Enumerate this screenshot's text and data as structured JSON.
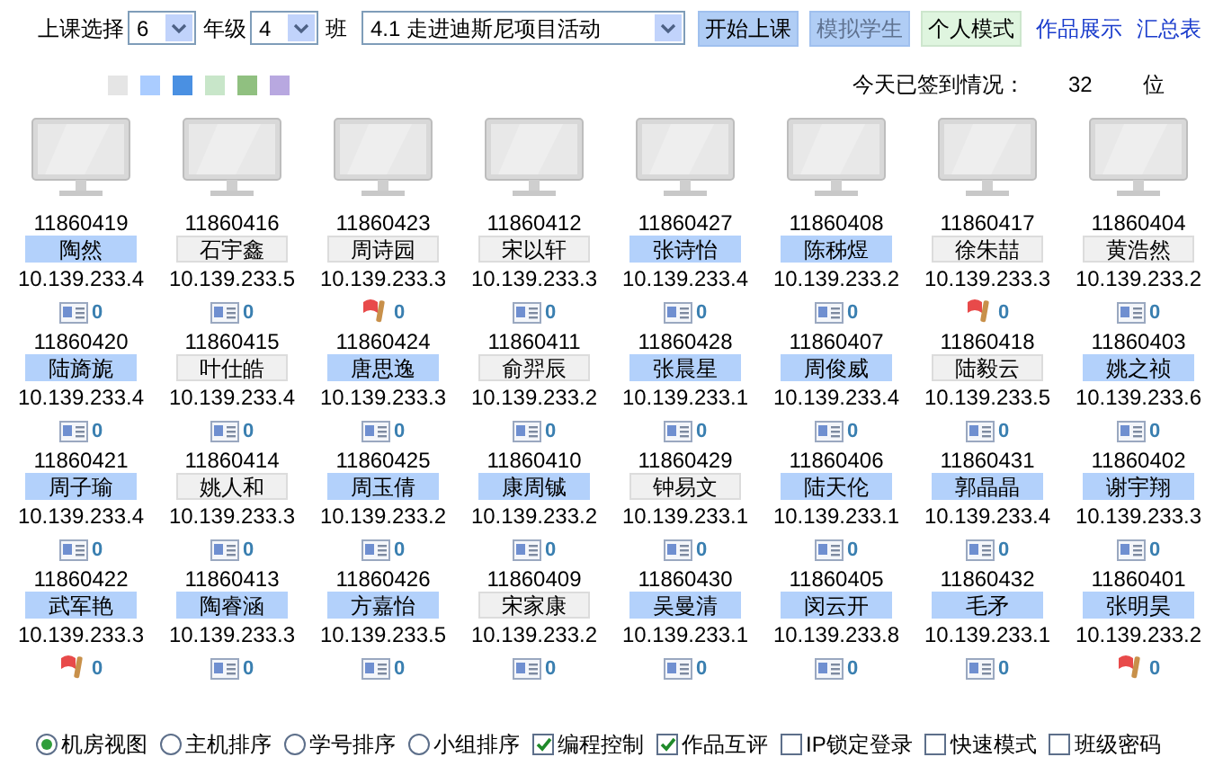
{
  "toolbar": {
    "grade_label": "上课选择",
    "grade": "6",
    "class_label_1": "年级",
    "class": "4",
    "class_label_2": "班",
    "lesson": "4.1 走进迪斯尼项目活动",
    "buttons": [
      {
        "label": "开始上课",
        "kind": "primary",
        "disabled": false
      },
      {
        "label": "模拟学生",
        "kind": "primary",
        "disabled": true
      },
      {
        "label": "个人模式",
        "kind": "mode",
        "disabled": false
      }
    ],
    "links": [
      "作品展示",
      "汇总表"
    ]
  },
  "legend": [
    {
      "color": "#e5e5e5"
    },
    {
      "color": "#aaccff"
    },
    {
      "color": "#4a90e2"
    },
    {
      "color": "#c8e6c9"
    },
    {
      "color": "#90c080"
    },
    {
      "color": "#b8a8e0"
    }
  ],
  "signin": {
    "label": "今天已签到情况：",
    "count": "32",
    "unit": "位"
  },
  "students": [
    {
      "id": "11860419",
      "name": "陶然",
      "highlighted": true,
      "ip": "10.139.233.4",
      "kind": "card",
      "count": "0",
      "monitor": true
    },
    {
      "id": "11860416",
      "name": "石宇鑫",
      "highlighted": false,
      "ip": "10.139.233.5",
      "kind": "card",
      "count": "0",
      "monitor": true
    },
    {
      "id": "11860423",
      "name": "周诗园",
      "highlighted": false,
      "ip": "10.139.233.3",
      "kind": "flag",
      "count": "0",
      "monitor": true
    },
    {
      "id": "11860412",
      "name": "宋以轩",
      "highlighted": false,
      "ip": "10.139.233.3",
      "kind": "card",
      "count": "0",
      "monitor": true
    },
    {
      "id": "11860427",
      "name": "张诗怡",
      "highlighted": true,
      "ip": "10.139.233.4",
      "kind": "card",
      "count": "0",
      "monitor": true
    },
    {
      "id": "11860408",
      "name": "陈秭煜",
      "highlighted": true,
      "ip": "10.139.233.2",
      "kind": "card",
      "count": "0",
      "monitor": true
    },
    {
      "id": "11860417",
      "name": "徐朱喆",
      "highlighted": false,
      "ip": "10.139.233.3",
      "kind": "flag",
      "count": "0",
      "monitor": true
    },
    {
      "id": "11860404",
      "name": "黄浩然",
      "highlighted": false,
      "ip": "10.139.233.2",
      "kind": "card",
      "count": "0",
      "monitor": true
    },
    {
      "id": "11860420",
      "name": "陆旖旎",
      "highlighted": true,
      "ip": "10.139.233.4",
      "kind": "card",
      "count": "0",
      "monitor": false
    },
    {
      "id": "11860415",
      "name": "叶仕皓",
      "highlighted": false,
      "ip": "10.139.233.4",
      "kind": "card",
      "count": "0",
      "monitor": false
    },
    {
      "id": "11860424",
      "name": "唐思逸",
      "highlighted": true,
      "ip": "10.139.233.3",
      "kind": "card",
      "count": "0",
      "monitor": false
    },
    {
      "id": "11860411",
      "name": "俞羿辰",
      "highlighted": false,
      "ip": "10.139.233.2",
      "kind": "card",
      "count": "0",
      "monitor": false
    },
    {
      "id": "11860428",
      "name": "张晨星",
      "highlighted": true,
      "ip": "10.139.233.1",
      "kind": "card",
      "count": "0",
      "monitor": false
    },
    {
      "id": "11860407",
      "name": "周俊威",
      "highlighted": true,
      "ip": "10.139.233.4",
      "kind": "card",
      "count": "0",
      "monitor": false
    },
    {
      "id": "11860418",
      "name": "陆毅云",
      "highlighted": false,
      "ip": "10.139.233.5",
      "kind": "card",
      "count": "0",
      "monitor": false
    },
    {
      "id": "11860403",
      "name": "姚之祯",
      "highlighted": true,
      "ip": "10.139.233.6",
      "kind": "card",
      "count": "0",
      "monitor": false
    },
    {
      "id": "11860421",
      "name": "周子瑜",
      "highlighted": true,
      "ip": "10.139.233.4",
      "kind": "card",
      "count": "0",
      "monitor": false
    },
    {
      "id": "11860414",
      "name": "姚人和",
      "highlighted": false,
      "ip": "10.139.233.3",
      "kind": "card",
      "count": "0",
      "monitor": false
    },
    {
      "id": "11860425",
      "name": "周玉倩",
      "highlighted": true,
      "ip": "10.139.233.2",
      "kind": "card",
      "count": "0",
      "monitor": false
    },
    {
      "id": "11860410",
      "name": "康周铖",
      "highlighted": true,
      "ip": "10.139.233.2",
      "kind": "card",
      "count": "0",
      "monitor": false
    },
    {
      "id": "11860429",
      "name": "钟易文",
      "highlighted": false,
      "ip": "10.139.233.1",
      "kind": "card",
      "count": "0",
      "monitor": false
    },
    {
      "id": "11860406",
      "name": "陆天伦",
      "highlighted": true,
      "ip": "10.139.233.1",
      "kind": "card",
      "count": "0",
      "monitor": false
    },
    {
      "id": "11860431",
      "name": "郭晶晶",
      "highlighted": true,
      "ip": "10.139.233.4",
      "kind": "card",
      "count": "0",
      "monitor": false
    },
    {
      "id": "11860402",
      "name": "谢宇翔",
      "highlighted": true,
      "ip": "10.139.233.3",
      "kind": "card",
      "count": "0",
      "monitor": false
    },
    {
      "id": "11860422",
      "name": "武军艳",
      "highlighted": true,
      "ip": "10.139.233.3",
      "kind": "flag",
      "count": "0",
      "monitor": false
    },
    {
      "id": "11860413",
      "name": "陶睿涵",
      "highlighted": true,
      "ip": "10.139.233.3",
      "kind": "card",
      "count": "0",
      "monitor": false
    },
    {
      "id": "11860426",
      "name": "方嘉怡",
      "highlighted": true,
      "ip": "10.139.233.5",
      "kind": "card",
      "count": "0",
      "monitor": false
    },
    {
      "id": "11860409",
      "name": "宋家康",
      "highlighted": false,
      "ip": "10.139.233.2",
      "kind": "card",
      "count": "0",
      "monitor": false
    },
    {
      "id": "11860430",
      "name": "吴曼清",
      "highlighted": true,
      "ip": "10.139.233.1",
      "kind": "card",
      "count": "0",
      "monitor": false
    },
    {
      "id": "11860405",
      "name": "闵云开",
      "highlighted": true,
      "ip": "10.139.233.8",
      "kind": "card",
      "count": "0",
      "monitor": false
    },
    {
      "id": "11860432",
      "name": "毛矛",
      "highlighted": true,
      "ip": "10.139.233.1",
      "kind": "card",
      "count": "0",
      "monitor": false
    },
    {
      "id": "11860401",
      "name": "张明昊",
      "highlighted": true,
      "ip": "10.139.233.2",
      "kind": "flag",
      "count": "0",
      "monitor": false
    }
  ],
  "options": [
    {
      "kind": "radio",
      "label": "机房视图",
      "selected": true
    },
    {
      "kind": "radio",
      "label": "主机排序",
      "selected": false
    },
    {
      "kind": "radio",
      "label": "学号排序",
      "selected": false
    },
    {
      "kind": "radio",
      "label": "小组排序",
      "selected": false
    },
    {
      "kind": "checkbox",
      "label": "编程控制",
      "checked": true
    },
    {
      "kind": "checkbox",
      "label": "作品互评",
      "checked": true
    },
    {
      "kind": "checkbox",
      "label": "IP锁定登录",
      "checked": false
    },
    {
      "kind": "checkbox",
      "label": "快速模式",
      "checked": false
    },
    {
      "kind": "checkbox",
      "label": "班级密码",
      "checked": false
    }
  ]
}
